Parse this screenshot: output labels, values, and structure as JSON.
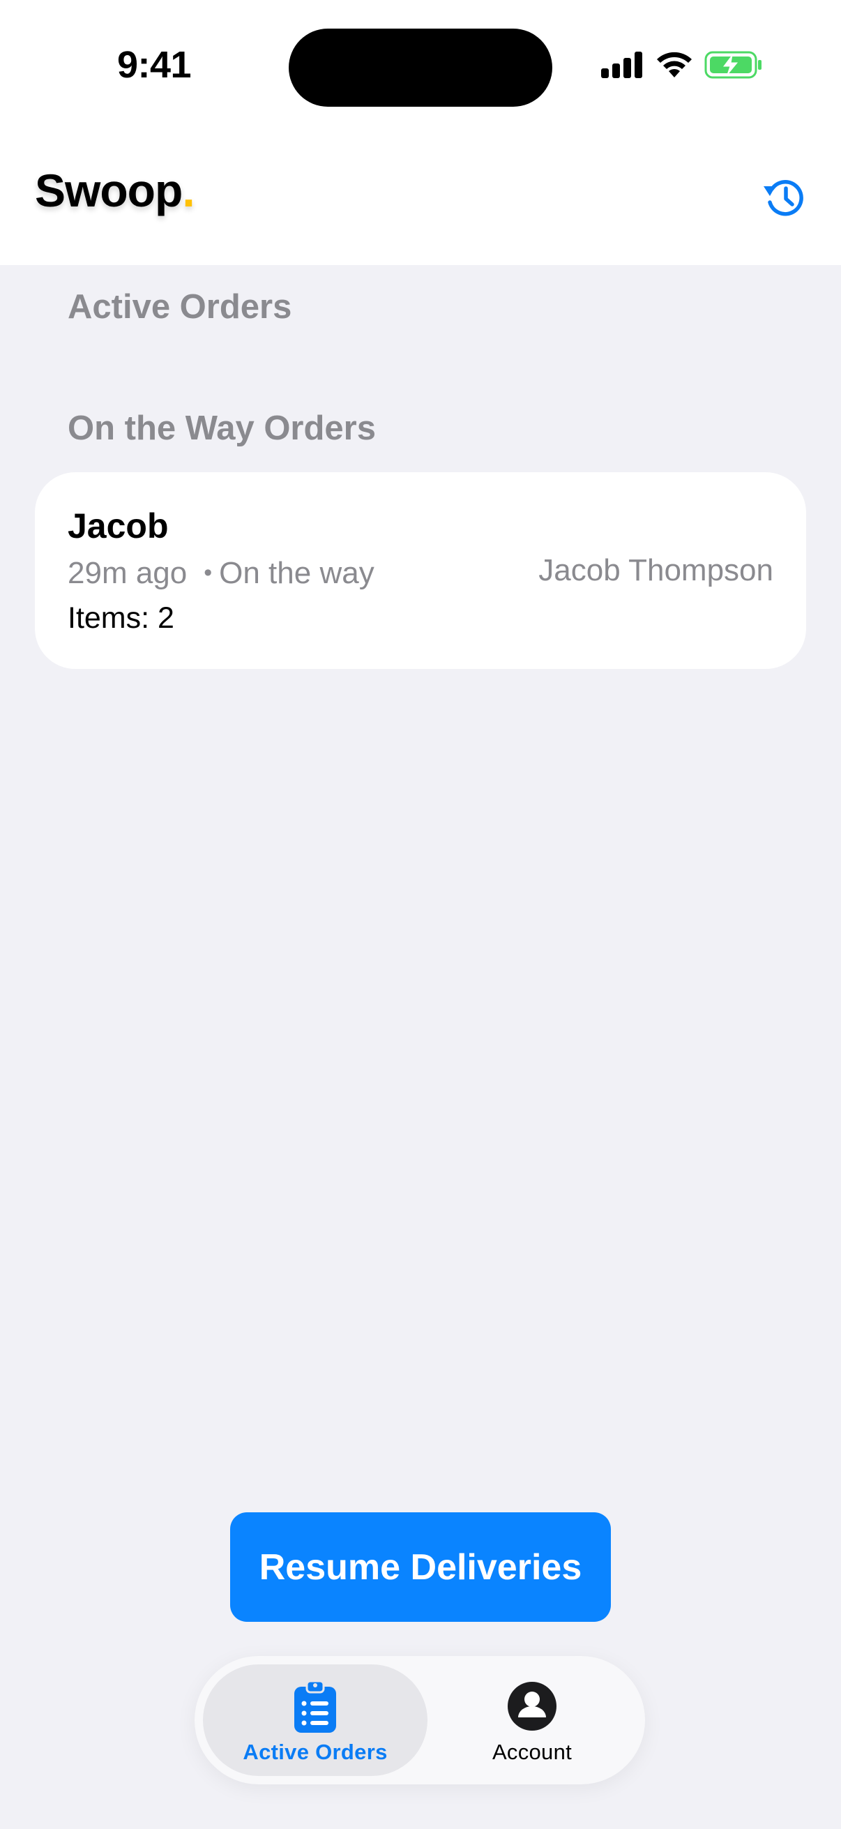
{
  "status_bar": {
    "time": "9:41"
  },
  "header": {
    "brand_name": "Swoop",
    "brand_dot": ".",
    "brand_dot_color": "#ffc107",
    "history_icon": "history-clock-icon"
  },
  "sections": {
    "active_title": "Active Orders",
    "on_the_way_title": "On the Way Orders"
  },
  "orders": [
    {
      "name": "Jacob",
      "time_ago": "29m ago",
      "separator": "•",
      "status": "On the way",
      "driver": "Jacob Thompson",
      "items": "Items: 2"
    }
  ],
  "actions": {
    "resume_label": "Resume Deliveries"
  },
  "tabbar": {
    "tabs": [
      {
        "label": "Active Orders",
        "icon": "clipboard-list-icon",
        "selected": true
      },
      {
        "label": "Account",
        "icon": "person-circle-icon",
        "selected": false
      }
    ]
  },
  "colors": {
    "accent": "#0a84ff",
    "background": "#f1f1f6",
    "secondary_text": "#8a8a8f"
  }
}
